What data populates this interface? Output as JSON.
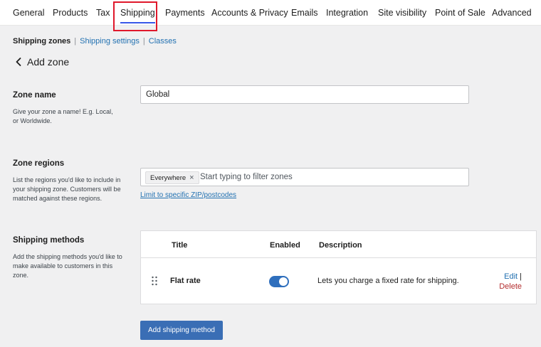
{
  "tabs": [
    {
      "label": "General"
    },
    {
      "label": "Products"
    },
    {
      "label": "Tax"
    },
    {
      "label": "Shipping"
    },
    {
      "label": "Payments"
    },
    {
      "label": "Accounts & Privacy"
    },
    {
      "label": "Emails"
    },
    {
      "label": "Integration"
    },
    {
      "label": "Site visibility"
    },
    {
      "label": "Point of Sale"
    },
    {
      "label": "Advanced"
    }
  ],
  "subnav": {
    "current": "Shipping zones",
    "separator": "|",
    "settings": "Shipping settings",
    "classes": "Classes"
  },
  "page": {
    "title": "Add zone"
  },
  "zone_name": {
    "label": "Zone name",
    "description": "Give your zone a name! E.g. Local, or Worldwide.",
    "value": "Global"
  },
  "zone_regions": {
    "label": "Zone regions",
    "description": "List the regions you'd like to include in your shipping zone. Customers will be matched against these regions.",
    "chip": "Everywhere",
    "chip_remove": "×",
    "placeholder": "Start typing to filter zones",
    "zip_link": "Limit to specific ZIP/postcodes"
  },
  "shipping_methods": {
    "label": "Shipping methods",
    "description": "Add the shipping methods you'd like to make available to customers in this zone.",
    "columns": {
      "title": "Title",
      "enabled": "Enabled",
      "description": "Description"
    },
    "rows": [
      {
        "title": "Flat rate",
        "enabled": true,
        "description": "Lets you charge a fixed rate for shipping.",
        "edit": "Edit",
        "pipe": "|",
        "delete": "Delete"
      }
    ],
    "add_button": "Add shipping method"
  },
  "colors": {
    "accent": "#3858e9",
    "link": "#2271b1",
    "toggle_on": "#2f6fbd",
    "button": "#3a6eb5",
    "delete": "#b32d2e",
    "highlight": "#e0182b"
  },
  "icons": {
    "back": "chevron-left-icon",
    "drag": "drag-handle-icon",
    "remove_chip": "close-icon"
  }
}
